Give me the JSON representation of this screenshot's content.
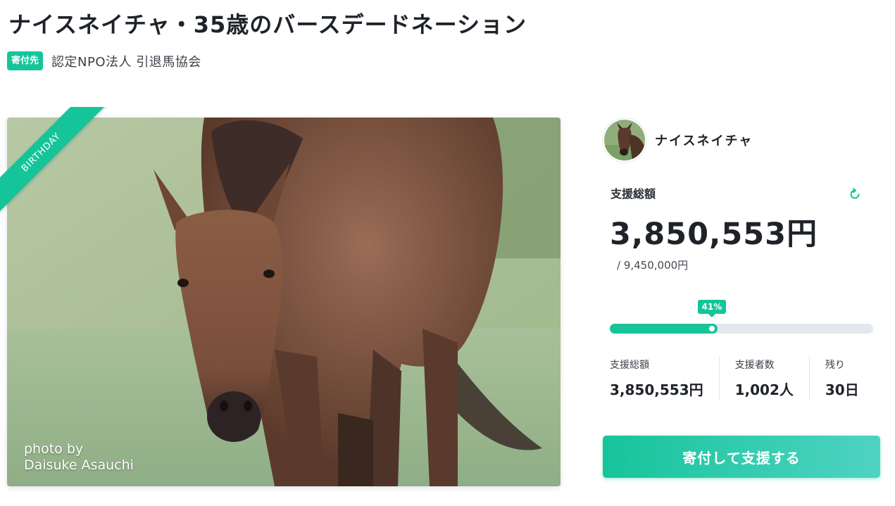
{
  "page": {
    "title": "ナイスネイチャ・35歳のバースデードネーション"
  },
  "donee": {
    "badge": "寄付先",
    "name": "認定NPO法人 引退馬協会"
  },
  "hero": {
    "ribbon": "BIRTHDAY",
    "credit_line1": "photo by",
    "credit_line2": "Daisuke Asauchi"
  },
  "owner": {
    "name": "ナイスネイチャ"
  },
  "funding": {
    "total_label": "支援総額",
    "total_amount": "3,850,553円",
    "goal": "/ 9,450,000円",
    "progress_label": "41%",
    "progress_fraction": 0.41
  },
  "stats": [
    {
      "label": "支援総額",
      "value": "3,850,553円"
    },
    {
      "label": "支援者数",
      "value": "1,002人"
    },
    {
      "label": "残り",
      "value": "30日"
    }
  ],
  "cta": {
    "label": "寄付して支援する"
  },
  "colors": {
    "accent": "#16c49a",
    "text": "#1f2329",
    "track": "#e3e8ef"
  },
  "icons": {
    "refresh": "refresh-icon"
  }
}
